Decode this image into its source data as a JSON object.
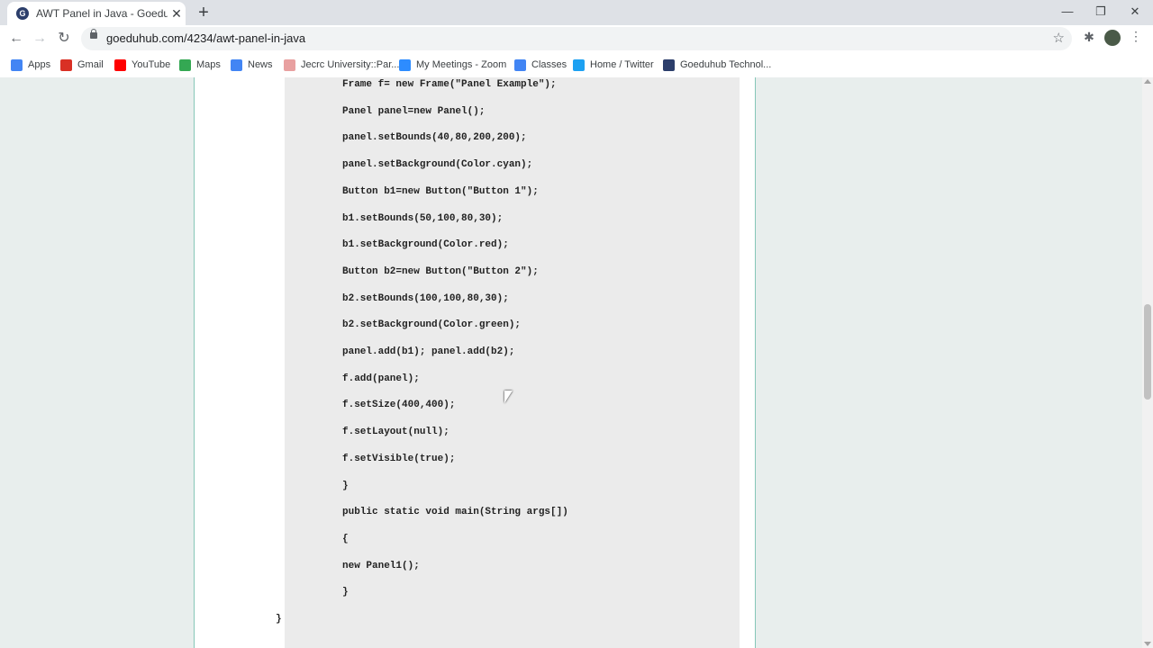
{
  "tab": {
    "title": "AWT Panel in Java - Goeduhub Te",
    "favicon": "G",
    "close": "✕"
  },
  "window": {
    "minimize": "—",
    "restore": "❐",
    "close": "✕",
    "new_tab": "+"
  },
  "nav": {
    "back": "←",
    "forward": "→",
    "reload": "↻"
  },
  "omnibox": {
    "url": "goeduhub.com/4234/awt-panel-in-java",
    "star": "☆"
  },
  "toolbar": {
    "extensions": "✱",
    "menu": "⋮"
  },
  "bookmarks": [
    {
      "label": "Apps",
      "icon": "apps-grid-icon",
      "color": "#4285f4"
    },
    {
      "label": "Gmail",
      "icon": "gmail-icon",
      "color": "#d93025"
    },
    {
      "label": "YouTube",
      "icon": "youtube-icon",
      "color": "#ff0000"
    },
    {
      "label": "Maps",
      "icon": "maps-pin-icon",
      "color": "#34a853"
    },
    {
      "label": "News",
      "icon": "news-icon",
      "color": "#4285f4"
    },
    {
      "label": "Jecrc University::Par...",
      "icon": "jecrc-icon",
      "color": "#e8a0a0"
    },
    {
      "label": "My Meetings - Zoom",
      "icon": "zoom-icon",
      "color": "#2d8cff"
    },
    {
      "label": "Classes",
      "icon": "google-icon",
      "color": "#4285f4"
    },
    {
      "label": "Home / Twitter",
      "icon": "twitter-icon",
      "color": "#1da1f2"
    },
    {
      "label": "Goeduhub Technol...",
      "icon": "goeduhub-icon",
      "color": "#2c3e6b"
    }
  ],
  "code_lines": [
    "Frame f= new Frame(\"Panel Example\");",
    "Panel panel=new Panel();",
    "panel.setBounds(40,80,200,200);",
    "panel.setBackground(Color.cyan);",
    "Button b1=new Button(\"Button 1\");",
    "b1.setBounds(50,100,80,30);",
    "b1.setBackground(Color.red);",
    "Button b2=new Button(\"Button 2\");",
    "b2.setBounds(100,100,80,30);",
    "b2.setBackground(Color.green);",
    "panel.add(b1); panel.add(b2);",
    "f.add(panel);",
    "f.setSize(400,400);",
    "f.setLayout(null);",
    "f.setVisible(true);",
    "}",
    "public static void main(String args[])",
    "{",
    "new Panel1();",
    "}",
    "}"
  ]
}
